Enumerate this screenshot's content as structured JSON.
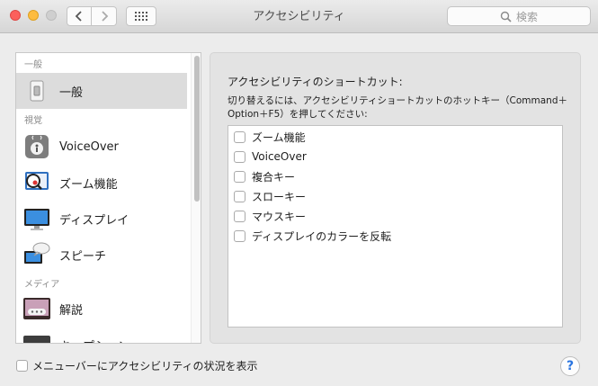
{
  "window": {
    "title": "アクセシビリティ"
  },
  "toolbar": {
    "back_icon": "chevron-left-icon",
    "forward_icon": "chevron-right-icon",
    "grid_icon": "grid-icon",
    "search_placeholder": "検索"
  },
  "sidebar": {
    "sections": [
      "一般",
      "視覚",
      "メディア"
    ],
    "items": [
      {
        "label": "一般",
        "icon": "switch-icon",
        "selected": true
      },
      {
        "label": "VoiceOver",
        "icon": "voiceover-icon"
      },
      {
        "label": "ズーム機能",
        "icon": "zoom-icon"
      },
      {
        "label": "ディスプレイ",
        "icon": "display-icon"
      },
      {
        "label": "スピーチ",
        "icon": "speech-icon"
      },
      {
        "label": "解説",
        "icon": "descriptions-icon"
      },
      {
        "label": "キャプション",
        "icon": "captions-icon"
      }
    ]
  },
  "panel": {
    "title": "アクセシビリティのショートカット:",
    "description": "切り替えるには、アクセシビリティショートカットのホットキー（Command＋Option＋F5）を押してください:",
    "options": [
      {
        "label": "ズーム機能",
        "checked": false
      },
      {
        "label": "VoiceOver",
        "checked": false
      },
      {
        "label": "複合キー",
        "checked": false
      },
      {
        "label": "スローキー",
        "checked": false
      },
      {
        "label": "マウスキー",
        "checked": false
      },
      {
        "label": "ディスプレイのカラーを反転",
        "checked": false
      }
    ]
  },
  "footer": {
    "menubar_status_label": "メニューバーにアクセシビリティの状況を表示",
    "help_label": "?"
  }
}
